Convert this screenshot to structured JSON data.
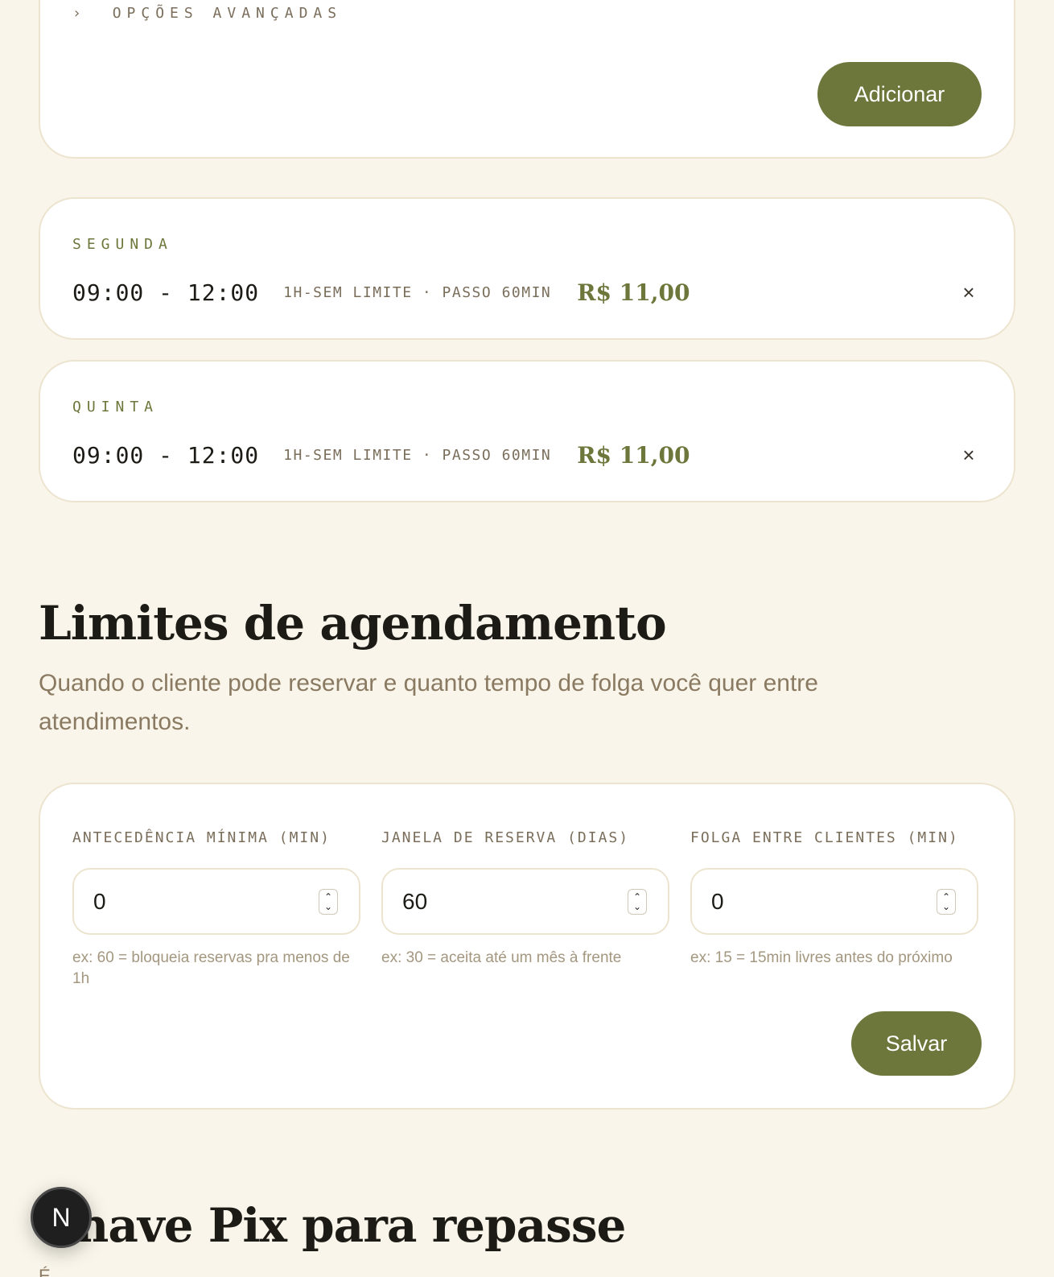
{
  "top_card": {
    "advanced_toggle_icon": "›",
    "advanced_toggle_label": "Opções avançadas",
    "add_button": "Adicionar"
  },
  "slots": [
    {
      "day": "Segunda",
      "time": "09:00 - 12:00",
      "meta": "1h-sem limite · passo 60min",
      "price": "R$ 11,00",
      "remove": "×"
    },
    {
      "day": "Quinta",
      "time": "09:00 - 12:00",
      "meta": "1h-sem limite · passo 60min",
      "price": "R$ 11,00",
      "remove": "×"
    }
  ],
  "limits": {
    "title": "Limites de agendamento",
    "subtitle": "Quando o cliente pode reservar e quanto tempo de folga você quer entre atendimentos.",
    "fields": [
      {
        "label": "Antecedência mínima (min)",
        "value": "0",
        "hint": "ex: 60 = bloqueia reservas pra menos de 1h"
      },
      {
        "label": "Janela de reserva (dias)",
        "value": "60",
        "hint": "ex: 30 = aceita até um mês à frente"
      },
      {
        "label": "Folga entre clientes (min)",
        "value": "0",
        "hint": "ex: 15 = 15min livres antes do próximo"
      }
    ],
    "save_button": "Salvar"
  },
  "pix": {
    "title": "Chave Pix para repasse",
    "subtitle_partial": "É"
  },
  "dev_badge": {
    "letter": "N",
    "icon": "nextjs-logo-icon"
  },
  "colors": {
    "background": "#f9f5ea",
    "accent": "#6e773b",
    "muted_text": "#8a7a62",
    "border": "#ece4cf"
  }
}
